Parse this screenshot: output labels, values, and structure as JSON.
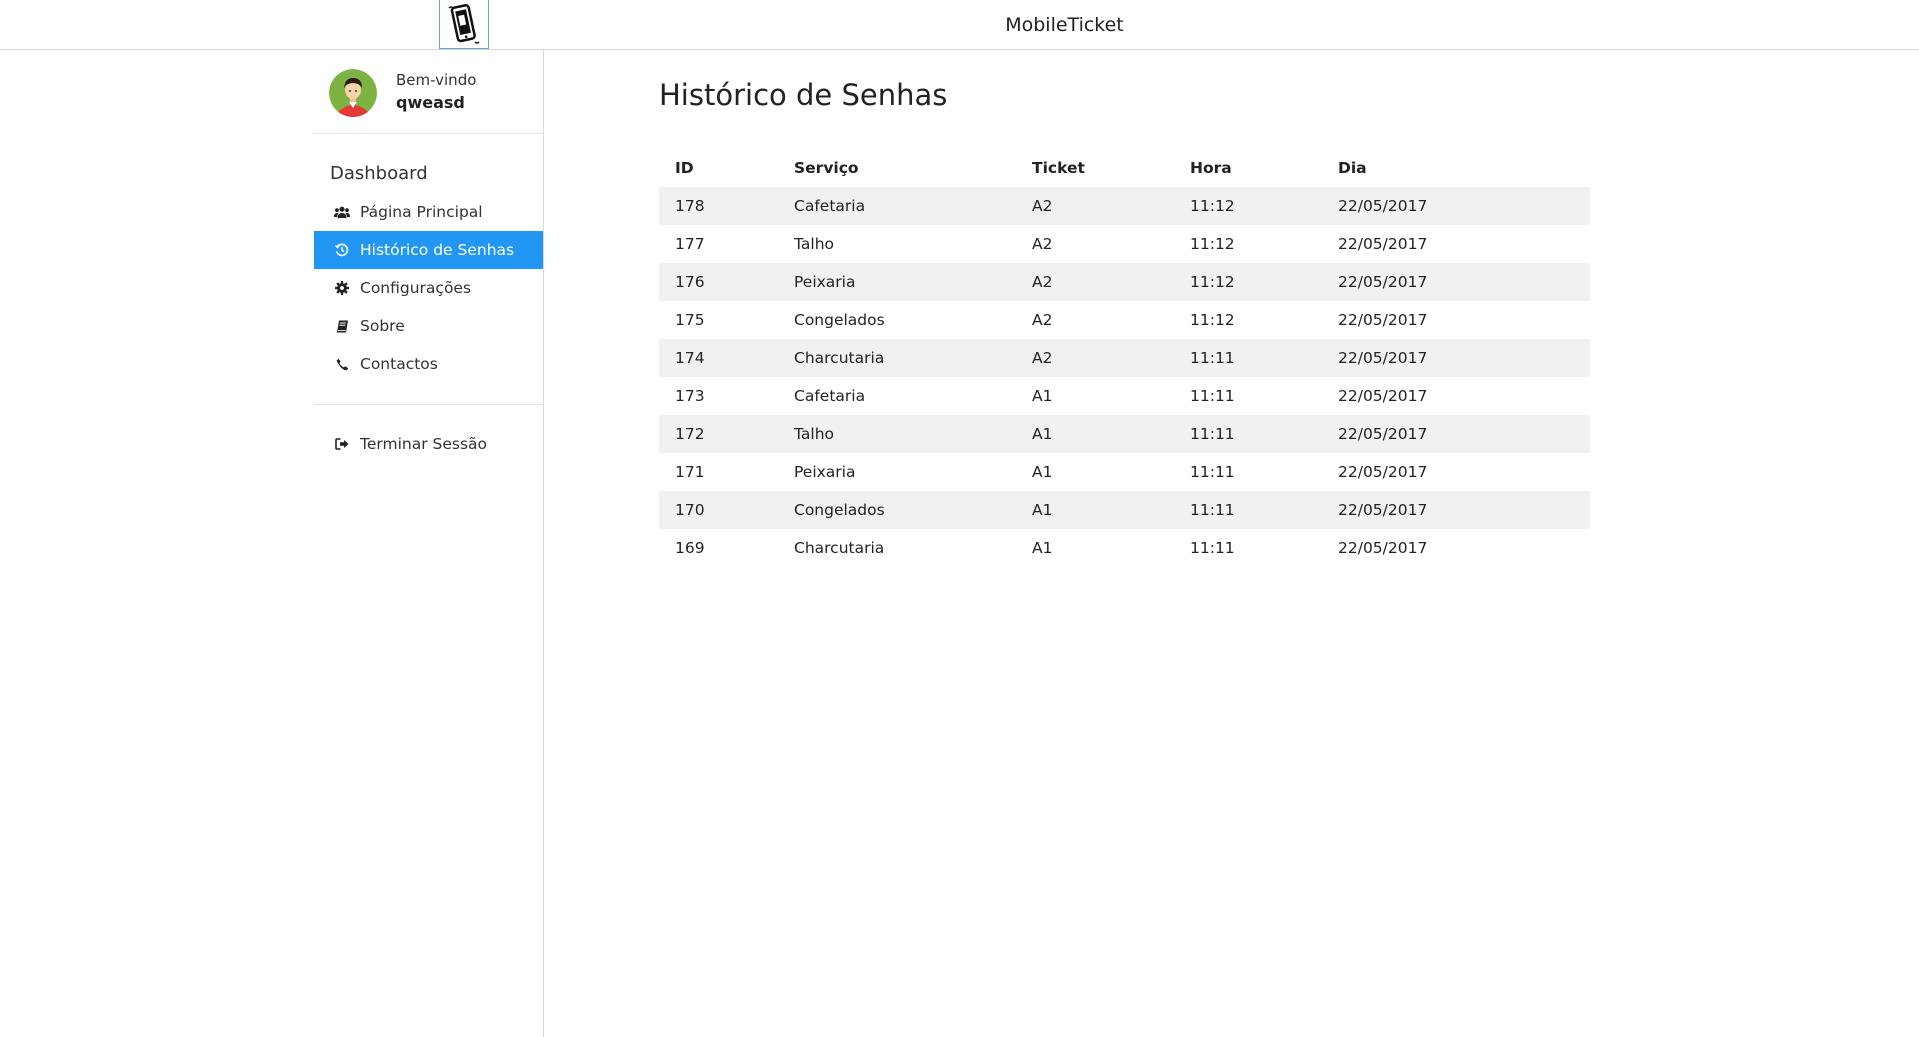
{
  "header": {
    "app_title": "MobileTicket"
  },
  "sidebar": {
    "welcome_label": "Bem-vindo",
    "username": "qweasd",
    "section_title": "Dashboard",
    "items": [
      {
        "label": "Página Principal",
        "icon": "users-icon"
      },
      {
        "label": "Histórico de Senhas",
        "icon": "history-icon",
        "active": true
      },
      {
        "label": "Configurações",
        "icon": "gear-icon"
      },
      {
        "label": "Sobre",
        "icon": "book-icon"
      },
      {
        "label": "Contactos",
        "icon": "phone-icon"
      }
    ],
    "logout_label": "Terminar Sessão"
  },
  "main": {
    "title": "Histórico de Senhas",
    "table": {
      "headers": [
        "ID",
        "Serviço",
        "Ticket",
        "Hora",
        "Dia"
      ],
      "rows": [
        [
          "178",
          "Cafetaria",
          "A2",
          "11:12",
          "22/05/2017"
        ],
        [
          "177",
          "Talho",
          "A2",
          "11:12",
          "22/05/2017"
        ],
        [
          "176",
          "Peixaria",
          "A2",
          "11:12",
          "22/05/2017"
        ],
        [
          "175",
          "Congelados",
          "A2",
          "11:12",
          "22/05/2017"
        ],
        [
          "174",
          "Charcutaria",
          "A2",
          "11:11",
          "22/05/2017"
        ],
        [
          "173",
          "Cafetaria",
          "A1",
          "11:11",
          "22/05/2017"
        ],
        [
          "172",
          "Talho",
          "A1",
          "11:11",
          "22/05/2017"
        ],
        [
          "171",
          "Peixaria",
          "A1",
          "11:11",
          "22/05/2017"
        ],
        [
          "170",
          "Congelados",
          "A1",
          "11:11",
          "22/05/2017"
        ],
        [
          "169",
          "Charcutaria",
          "A1",
          "11:11",
          "22/05/2017"
        ]
      ]
    }
  },
  "colors": {
    "accent": "#2196f3",
    "row_stripe": "#f1f1f1",
    "border": "#d8d8d8"
  }
}
